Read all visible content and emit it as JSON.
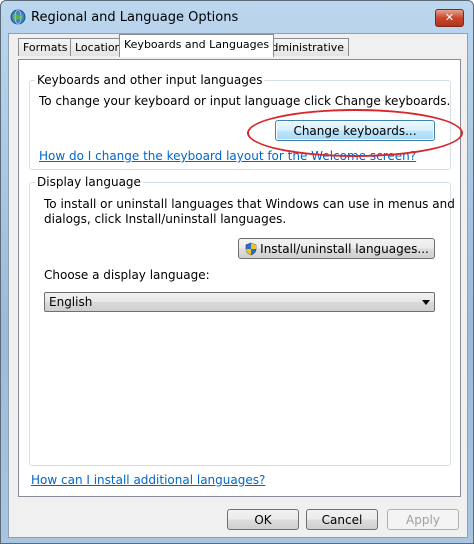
{
  "window": {
    "title": "Regional and Language Options",
    "close_label": "✕"
  },
  "tabs": [
    {
      "label": "Formats"
    },
    {
      "label": "Location"
    },
    {
      "label": "Keyboards and Languages"
    },
    {
      "label": "Administrative"
    }
  ],
  "keyboards_group": {
    "label": "Keyboards and other input languages",
    "description": "To change your keyboard or input language click Change keyboards.",
    "change_button": "Change keyboards...",
    "help_link": "How do I change the keyboard layout for the Welcome screen?"
  },
  "display_group": {
    "label": "Display language",
    "description_line1": "To install or uninstall languages that Windows can use in menus and",
    "description_line2": "dialogs, click Install/uninstall languages.",
    "install_button": "Install/uninstall languages...",
    "choose_label": "Choose a display language:",
    "selected_language": "English"
  },
  "install_link": "How can I install additional languages?",
  "footer": {
    "ok": "OK",
    "cancel": "Cancel",
    "apply": "Apply"
  },
  "icons": {
    "app": "globe-icon",
    "shield": "uac-shield-icon",
    "dropdown": "chevron-down-icon"
  },
  "colors": {
    "link": "#0066cc",
    "highlight": "#d8262a",
    "focus": "#3c7fb1"
  }
}
